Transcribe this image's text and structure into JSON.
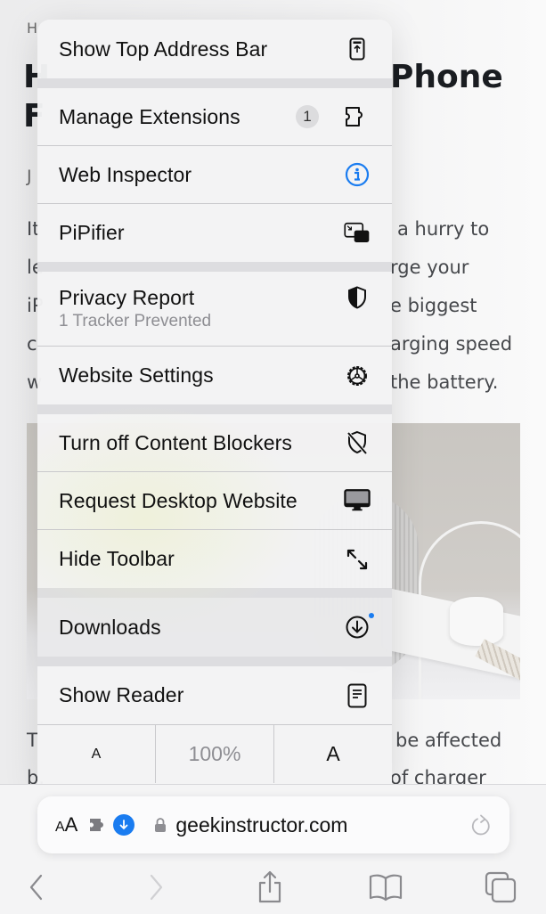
{
  "page": {
    "title_line1_visible": "Phone",
    "body_fragments": [
      "a hurry to",
      "rge your",
      "e biggest",
      "arging speed",
      "the battery.",
      "be affected",
      "of charger"
    ],
    "left_fragments": [
      "H",
      "J",
      "It",
      "le",
      "iP",
      "c",
      "w",
      "T",
      "b."
    ],
    "title_left_fragments": [
      "H",
      "F"
    ],
    "image_description": "white charger plugged into power strip"
  },
  "menu": {
    "items": [
      {
        "label": "Show Top Address Bar",
        "icon": "top-address-bar-icon"
      },
      {
        "label": "Manage Extensions",
        "badge": "1",
        "icon": "puzzle-piece-icon"
      },
      {
        "label": "Web Inspector",
        "icon": "info-circle-icon"
      },
      {
        "label": "PiPifier",
        "icon": "picture-in-picture-icon"
      },
      {
        "label": "Privacy Report",
        "sublabel": "1 Tracker Prevented",
        "icon": "half-shield-icon"
      },
      {
        "label": "Website Settings",
        "icon": "gear-icon"
      },
      {
        "label": "Turn off Content Blockers",
        "icon": "shield-slash-icon"
      },
      {
        "label": "Request Desktop Website",
        "icon": "desktop-computer-icon"
      },
      {
        "label": "Hide Toolbar",
        "icon": "expand-arrows-icon"
      },
      {
        "label": "Downloads",
        "icon": "download-circle-icon",
        "has_notification_dot": true
      },
      {
        "label": "Show Reader",
        "icon": "reader-document-icon"
      }
    ],
    "zoom": {
      "decrease_label": "A",
      "level": "100%",
      "increase_label": "A"
    }
  },
  "address_bar": {
    "aa_small": "A",
    "aa_large": "A",
    "url": "geekinstructor.com",
    "secure": true
  },
  "toolbar": {
    "buttons": [
      "back",
      "forward",
      "share",
      "bookmarks",
      "tabs"
    ],
    "forward_enabled": false
  },
  "colors": {
    "accent_blue": "#1a7cf0",
    "menu_bg": "#f3f3f4",
    "separator": "#dddde0",
    "secondary_text": "#8e8e93"
  }
}
